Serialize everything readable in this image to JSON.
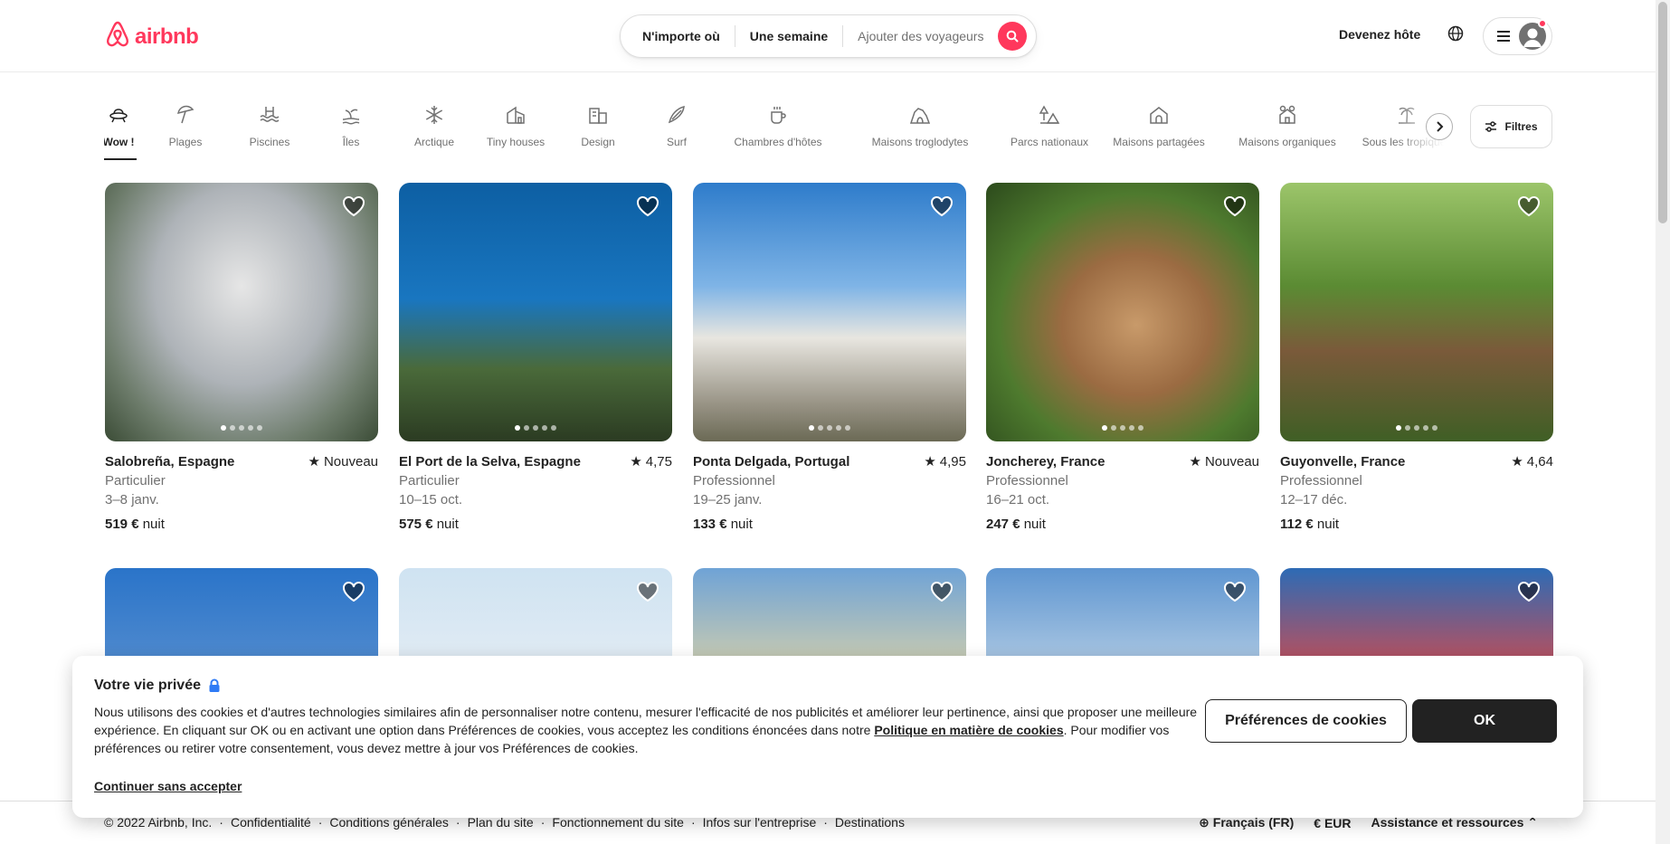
{
  "header": {
    "logo_text": "airbnb",
    "search": {
      "anywhere": "N'importe où",
      "week": "Une semaine",
      "guests_placeholder": "Ajouter des voyageurs"
    },
    "host_link": "Devenez hôte"
  },
  "categories": [
    {
      "label": "Wow !",
      "icon": "ufo-icon",
      "active": true
    },
    {
      "label": "Plages",
      "icon": "beach-umbrella-icon"
    },
    {
      "label": "Piscines",
      "icon": "pool-icon"
    },
    {
      "label": "Îles",
      "icon": "island-icon"
    },
    {
      "label": "Arctique",
      "icon": "snowflake-icon"
    },
    {
      "label": "Tiny houses",
      "icon": "tiny-house-icon"
    },
    {
      "label": "Design",
      "icon": "design-building-icon"
    },
    {
      "label": "Surf",
      "icon": "surfboard-icon"
    },
    {
      "label": "Chambres d'hôtes",
      "icon": "mug-icon"
    },
    {
      "label": "Maisons troglodytes",
      "icon": "cave-icon"
    },
    {
      "label": "Parcs nationaux",
      "icon": "national-park-icon"
    },
    {
      "label": "Maisons partagées",
      "icon": "shared-home-icon"
    },
    {
      "label": "Maisons organiques",
      "icon": "organic-home-icon"
    },
    {
      "label": "Sous les tropiques",
      "icon": "palm-tree-icon"
    }
  ],
  "filters_label": "Filtres",
  "listings": [
    {
      "location": "Salobreña, Espagne",
      "rating": "Nouveau",
      "host": "Particulier",
      "dates": "3–8 janv.",
      "price": "519 €",
      "unit": "nuit"
    },
    {
      "location": "El Port de la Selva, Espagne",
      "rating": "4,75",
      "host": "Particulier",
      "dates": "10–15 oct.",
      "price": "575 €",
      "unit": "nuit"
    },
    {
      "location": "Ponta Delgada, Portugal",
      "rating": "4,95",
      "host": "Professionnel",
      "dates": "19–25 janv.",
      "price": "133 €",
      "unit": "nuit"
    },
    {
      "location": "Joncherey, France",
      "rating": "Nouveau",
      "host": "Professionnel",
      "dates": "16–21 oct.",
      "price": "247 €",
      "unit": "nuit"
    },
    {
      "location": "Guyonvelle, France",
      "rating": "4,64",
      "host": "Professionnel",
      "dates": "12–17 déc.",
      "price": "112 €",
      "unit": "nuit"
    }
  ],
  "cookie": {
    "title": "Votre vie privée",
    "text_before": "Nous utilisons des cookies et d'autres technologies similaires afin de personnaliser notre contenu, mesurer l'efficacité de nos publicités et améliorer leur pertinence, ainsi que proposer une meilleure expérience. En cliquant sur OK ou en activant une option dans Préférences de cookies, vous acceptez les conditions énoncées dans notre ",
    "policy_link": "Politique en matière de cookies",
    "text_after": ". Pour modifier vos préférences ou retirer votre consentement, vous devez mettre à jour vos Préférences de cookies.",
    "continue_link": "Continuer sans accepter",
    "prefs_button": "Préférences de cookies",
    "ok_button": "OK"
  },
  "footer": {
    "copyright": "© 2022 Airbnb, Inc.",
    "links": [
      "Confidentialité",
      "Conditions générales",
      "Plan du site",
      "Fonctionnement du site",
      "Infos sur l'entreprise",
      "Destinations"
    ],
    "language": "Français (FR)",
    "currency_symbol": "€",
    "currency": "EUR",
    "support": "Assistance et ressources"
  },
  "colors": {
    "brand": "#ff385c",
    "text": "#222222",
    "muted": "#717171"
  }
}
